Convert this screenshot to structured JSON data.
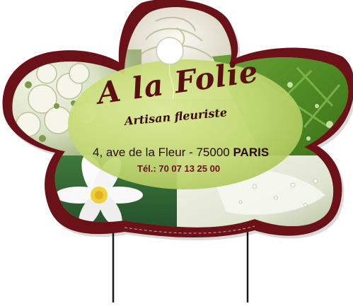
{
  "sign": {
    "brand_name": "A la Folie",
    "tagline": "Artisan fleuriste",
    "address_street": "4, ave de la Fleur - 75000",
    "address_city": "PARIS",
    "phone": "Tél.: 70 07 13 25 00"
  },
  "colors": {
    "frame": "#6b1219",
    "frame_dark": "#4e0b10",
    "oval": "#c7dc7a",
    "text_dark": "#3a0a0c",
    "stake": "#1a1a1a"
  }
}
